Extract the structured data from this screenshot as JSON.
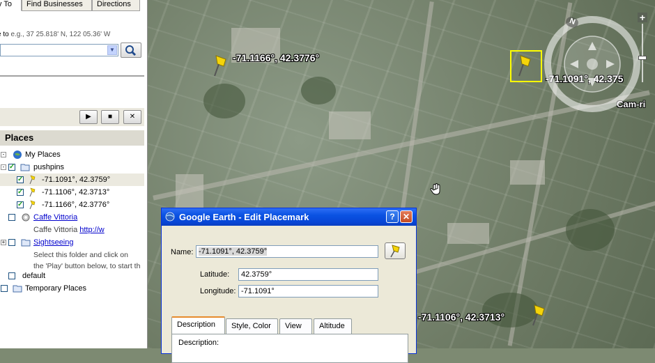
{
  "sidebar": {
    "tabs": [
      {
        "label": "y To",
        "active": true
      },
      {
        "label": "Find Businesses",
        "active": false
      },
      {
        "label": "Directions",
        "active": false
      }
    ],
    "fly_to": {
      "label_prefix": "e to",
      "hint": "e.g., 37 25.818' N, 122 05.36' W",
      "value": ""
    },
    "playbar": {
      "play": "▶",
      "stop": "■",
      "close": "✕"
    },
    "places_header": "Places",
    "tree": {
      "my_places": "My Places",
      "pushpins": "pushpins",
      "pin1": "-71.1091°, 42.3759°",
      "pin2": "-71.1106°, 42.3713°",
      "pin3": "-71.1166°, 42.3776°",
      "caffe": "Caffe Vittoria",
      "caffe_desc": "Caffe Vittoria",
      "caffe_link": "http://w",
      "sightseeing": "Sightseeing",
      "sight_desc1": "Select this folder and click on",
      "sight_desc2": "the 'Play' button below, to start th",
      "default": "default",
      "temporary": "Temporary Places"
    }
  },
  "map": {
    "labels": {
      "pin3": "-71.1166°, 42.3776°",
      "pin1": "-71.1091°, 42.375",
      "pin2": "-71.1106°, 42.3713°",
      "city": "Cam-ri"
    },
    "compass_north": "N"
  },
  "dialog": {
    "title": "Google Earth - Edit Placemark",
    "help": "?",
    "close": "✕",
    "name_label": "Name:",
    "name_value": "-71.1091°, 42.3759°",
    "lat_label": "Latitude:",
    "lat_value": "42.3759°",
    "lon_label": "Longitude:",
    "lon_value": "-71.1091°",
    "tabs": [
      "Description",
      "Style, Color",
      "View",
      "Altitude"
    ],
    "description_label": "Description:"
  },
  "colors": {
    "selection": "#ffff00",
    "titlebar": "#0a52e2",
    "link": "#0000cc"
  }
}
